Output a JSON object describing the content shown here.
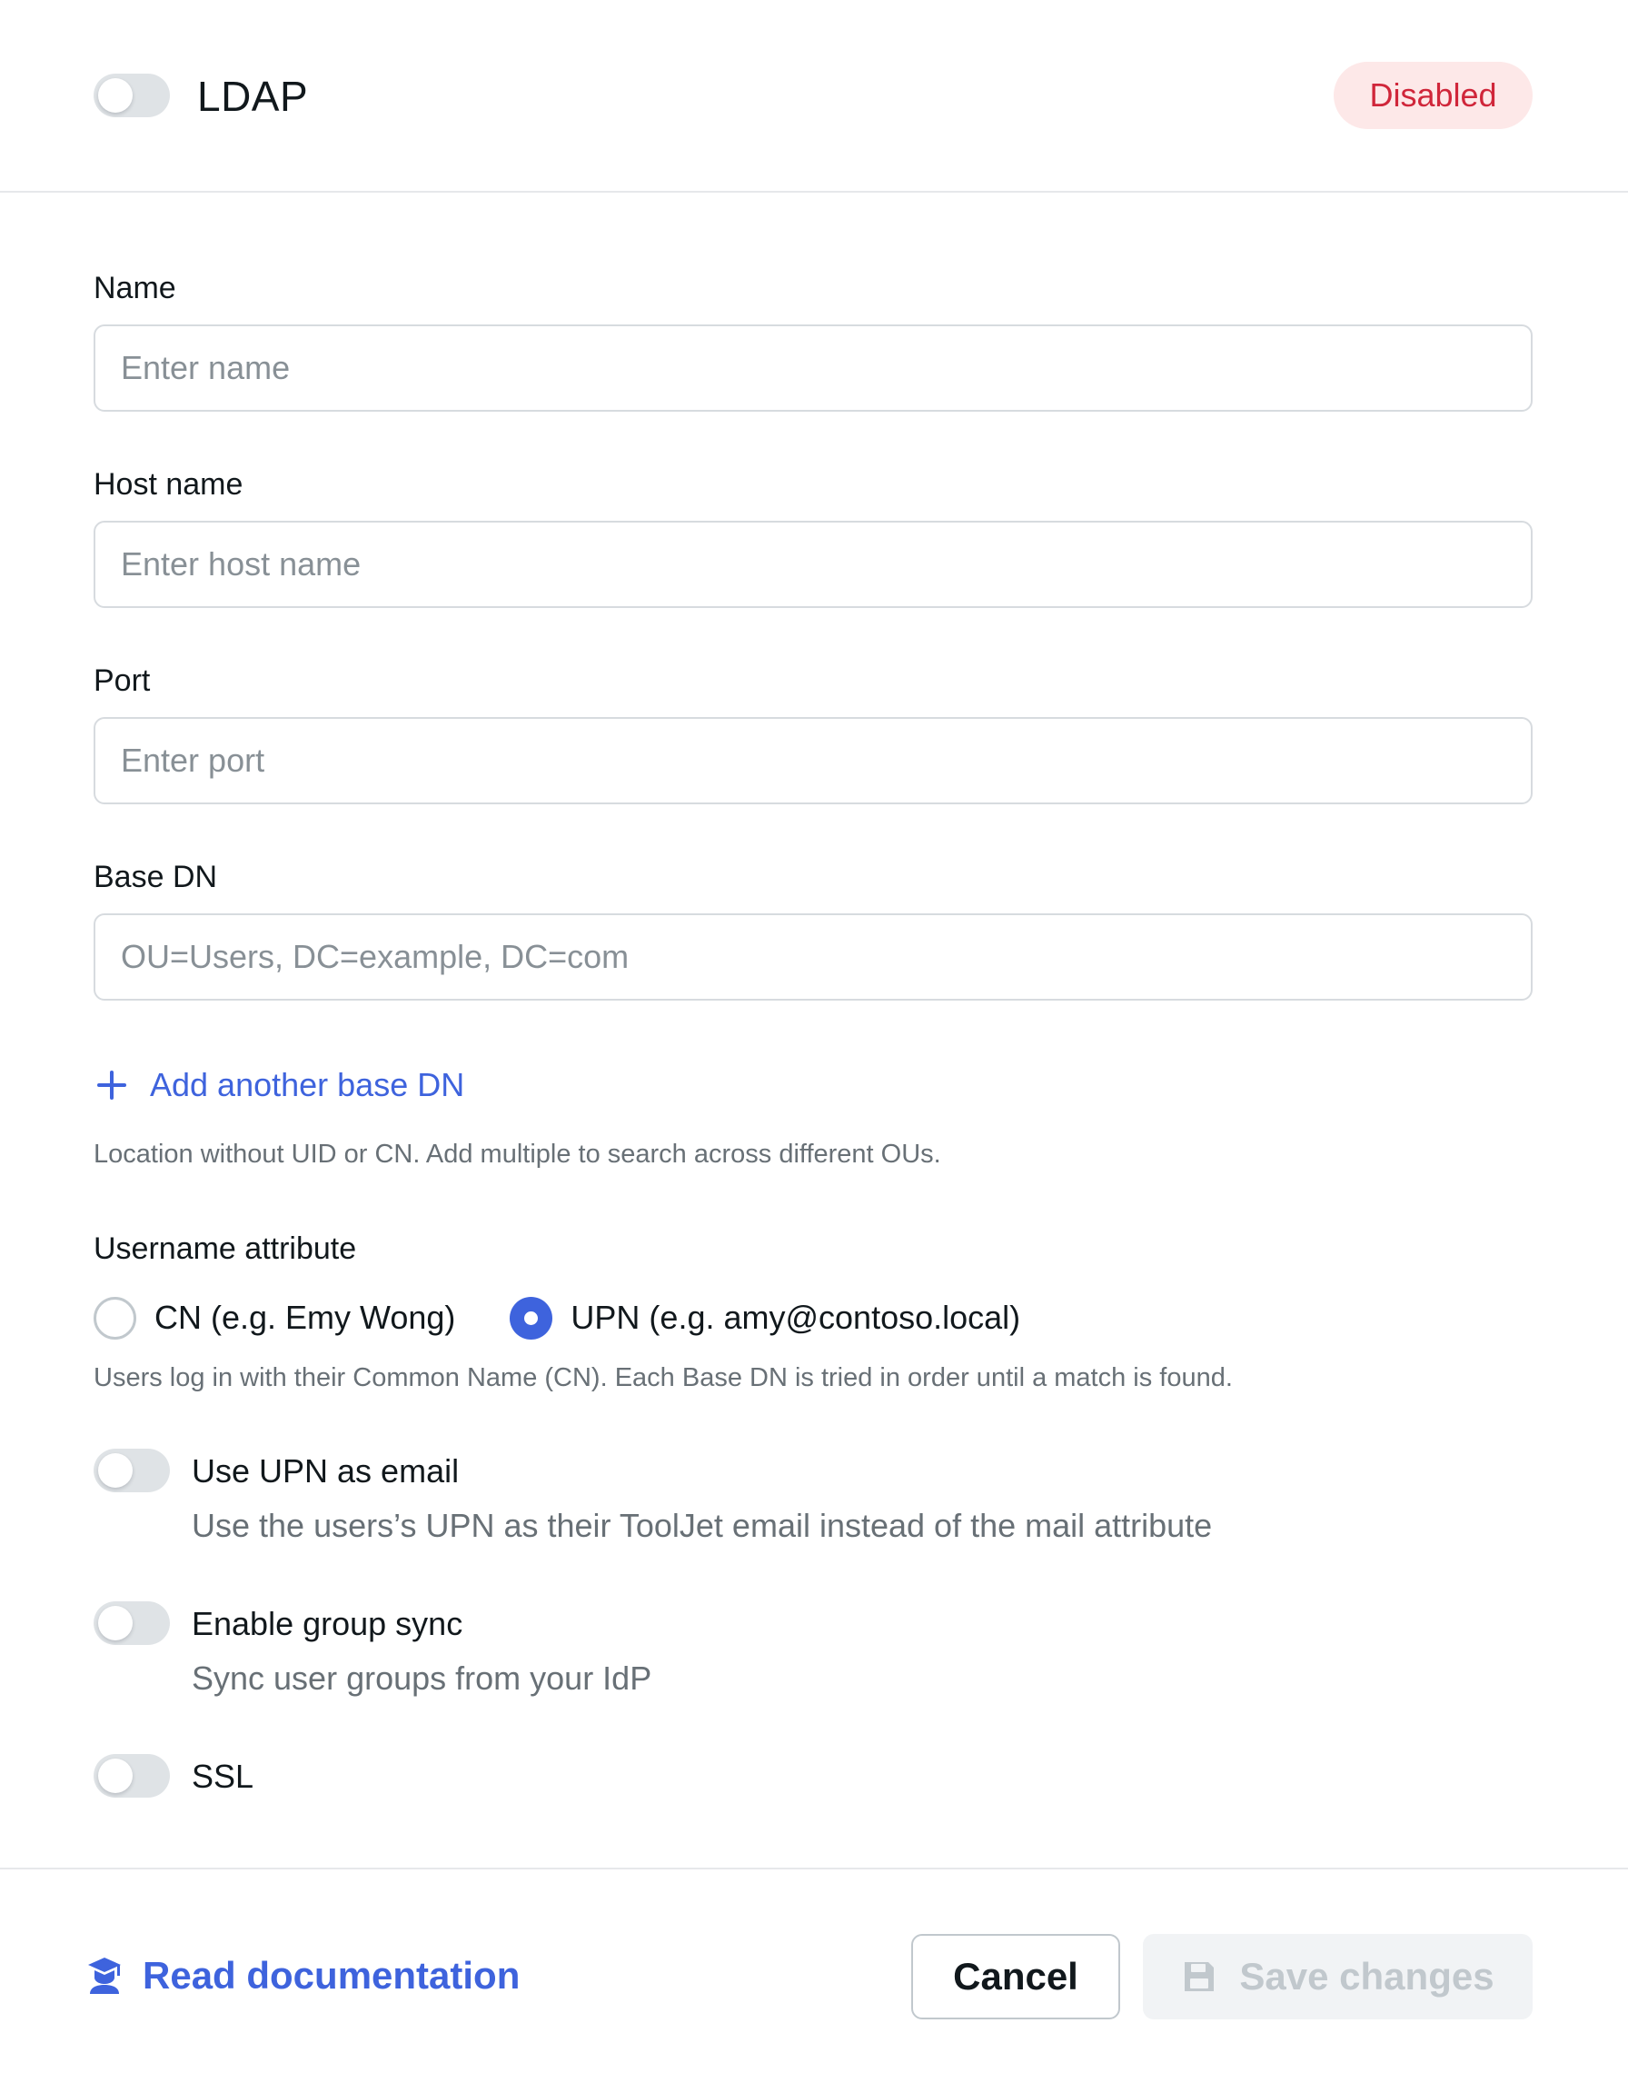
{
  "header": {
    "title": "LDAP",
    "enabled": false,
    "status": "Disabled"
  },
  "form": {
    "name": {
      "label": "Name",
      "placeholder": "Enter name",
      "value": ""
    },
    "host": {
      "label": "Host name",
      "placeholder": "Enter host name",
      "value": ""
    },
    "port": {
      "label": "Port",
      "placeholder": "Enter port",
      "value": ""
    },
    "base_dn": {
      "label": "Base DN",
      "placeholder": "OU=Users, DC=example, DC=com",
      "value": "",
      "add_label": "Add another base DN",
      "helper": "Location without UID or CN. Add multiple to search across different OUs."
    },
    "username_attribute": {
      "label": "Username attribute",
      "options": [
        {
          "label": "CN (e.g. Emy Wong)",
          "checked": false
        },
        {
          "label": "UPN (e.g. amy@contoso.local)",
          "checked": true
        }
      ],
      "helper": "Users log in with their Common Name (CN). Each Base DN is tried in order until a match is found."
    },
    "toggles": [
      {
        "title": "Use UPN as email",
        "description": "Use the users’s UPN as their ToolJet email instead of the mail attribute",
        "enabled": false
      },
      {
        "title": "Enable group sync",
        "description": "Sync user groups from your IdP",
        "enabled": false
      },
      {
        "title": "SSL",
        "description": "",
        "enabled": false
      }
    ]
  },
  "footer": {
    "docs_label": "Read documentation",
    "cancel_label": "Cancel",
    "save_label": "Save changes"
  },
  "colors": {
    "accent": "#3e63dd",
    "danger_text": "#d0263a",
    "danger_bg": "#fde8e8",
    "toggle_off": "#dfe3e6"
  }
}
